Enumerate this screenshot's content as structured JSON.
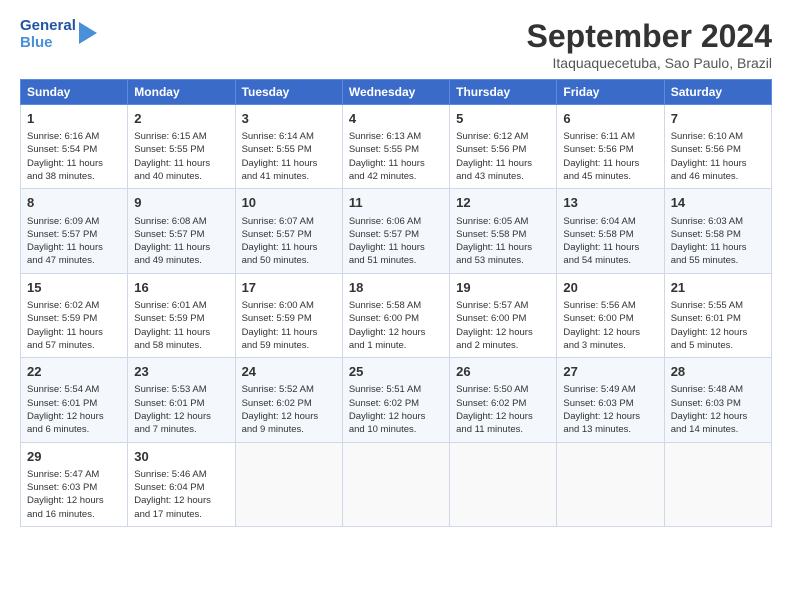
{
  "header": {
    "logo_line1": "General",
    "logo_line2": "Blue",
    "month": "September 2024",
    "location": "Itaquaquecetuba, Sao Paulo, Brazil"
  },
  "days_of_week": [
    "Sunday",
    "Monday",
    "Tuesday",
    "Wednesday",
    "Thursday",
    "Friday",
    "Saturday"
  ],
  "weeks": [
    [
      {
        "day": "1",
        "info": "Sunrise: 6:16 AM\nSunset: 5:54 PM\nDaylight: 11 hours\nand 38 minutes."
      },
      {
        "day": "2",
        "info": "Sunrise: 6:15 AM\nSunset: 5:55 PM\nDaylight: 11 hours\nand 40 minutes."
      },
      {
        "day": "3",
        "info": "Sunrise: 6:14 AM\nSunset: 5:55 PM\nDaylight: 11 hours\nand 41 minutes."
      },
      {
        "day": "4",
        "info": "Sunrise: 6:13 AM\nSunset: 5:55 PM\nDaylight: 11 hours\nand 42 minutes."
      },
      {
        "day": "5",
        "info": "Sunrise: 6:12 AM\nSunset: 5:56 PM\nDaylight: 11 hours\nand 43 minutes."
      },
      {
        "day": "6",
        "info": "Sunrise: 6:11 AM\nSunset: 5:56 PM\nDaylight: 11 hours\nand 45 minutes."
      },
      {
        "day": "7",
        "info": "Sunrise: 6:10 AM\nSunset: 5:56 PM\nDaylight: 11 hours\nand 46 minutes."
      }
    ],
    [
      {
        "day": "8",
        "info": "Sunrise: 6:09 AM\nSunset: 5:57 PM\nDaylight: 11 hours\nand 47 minutes."
      },
      {
        "day": "9",
        "info": "Sunrise: 6:08 AM\nSunset: 5:57 PM\nDaylight: 11 hours\nand 49 minutes."
      },
      {
        "day": "10",
        "info": "Sunrise: 6:07 AM\nSunset: 5:57 PM\nDaylight: 11 hours\nand 50 minutes."
      },
      {
        "day": "11",
        "info": "Sunrise: 6:06 AM\nSunset: 5:57 PM\nDaylight: 11 hours\nand 51 minutes."
      },
      {
        "day": "12",
        "info": "Sunrise: 6:05 AM\nSunset: 5:58 PM\nDaylight: 11 hours\nand 53 minutes."
      },
      {
        "day": "13",
        "info": "Sunrise: 6:04 AM\nSunset: 5:58 PM\nDaylight: 11 hours\nand 54 minutes."
      },
      {
        "day": "14",
        "info": "Sunrise: 6:03 AM\nSunset: 5:58 PM\nDaylight: 11 hours\nand 55 minutes."
      }
    ],
    [
      {
        "day": "15",
        "info": "Sunrise: 6:02 AM\nSunset: 5:59 PM\nDaylight: 11 hours\nand 57 minutes."
      },
      {
        "day": "16",
        "info": "Sunrise: 6:01 AM\nSunset: 5:59 PM\nDaylight: 11 hours\nand 58 minutes."
      },
      {
        "day": "17",
        "info": "Sunrise: 6:00 AM\nSunset: 5:59 PM\nDaylight: 11 hours\nand 59 minutes."
      },
      {
        "day": "18",
        "info": "Sunrise: 5:58 AM\nSunset: 6:00 PM\nDaylight: 12 hours\nand 1 minute."
      },
      {
        "day": "19",
        "info": "Sunrise: 5:57 AM\nSunset: 6:00 PM\nDaylight: 12 hours\nand 2 minutes."
      },
      {
        "day": "20",
        "info": "Sunrise: 5:56 AM\nSunset: 6:00 PM\nDaylight: 12 hours\nand 3 minutes."
      },
      {
        "day": "21",
        "info": "Sunrise: 5:55 AM\nSunset: 6:01 PM\nDaylight: 12 hours\nand 5 minutes."
      }
    ],
    [
      {
        "day": "22",
        "info": "Sunrise: 5:54 AM\nSunset: 6:01 PM\nDaylight: 12 hours\nand 6 minutes."
      },
      {
        "day": "23",
        "info": "Sunrise: 5:53 AM\nSunset: 6:01 PM\nDaylight: 12 hours\nand 7 minutes."
      },
      {
        "day": "24",
        "info": "Sunrise: 5:52 AM\nSunset: 6:02 PM\nDaylight: 12 hours\nand 9 minutes."
      },
      {
        "day": "25",
        "info": "Sunrise: 5:51 AM\nSunset: 6:02 PM\nDaylight: 12 hours\nand 10 minutes."
      },
      {
        "day": "26",
        "info": "Sunrise: 5:50 AM\nSunset: 6:02 PM\nDaylight: 12 hours\nand 11 minutes."
      },
      {
        "day": "27",
        "info": "Sunrise: 5:49 AM\nSunset: 6:03 PM\nDaylight: 12 hours\nand 13 minutes."
      },
      {
        "day": "28",
        "info": "Sunrise: 5:48 AM\nSunset: 6:03 PM\nDaylight: 12 hours\nand 14 minutes."
      }
    ],
    [
      {
        "day": "29",
        "info": "Sunrise: 5:47 AM\nSunset: 6:03 PM\nDaylight: 12 hours\nand 16 minutes."
      },
      {
        "day": "30",
        "info": "Sunrise: 5:46 AM\nSunset: 6:04 PM\nDaylight: 12 hours\nand 17 minutes."
      },
      {
        "day": "",
        "info": ""
      },
      {
        "day": "",
        "info": ""
      },
      {
        "day": "",
        "info": ""
      },
      {
        "day": "",
        "info": ""
      },
      {
        "day": "",
        "info": ""
      }
    ]
  ]
}
